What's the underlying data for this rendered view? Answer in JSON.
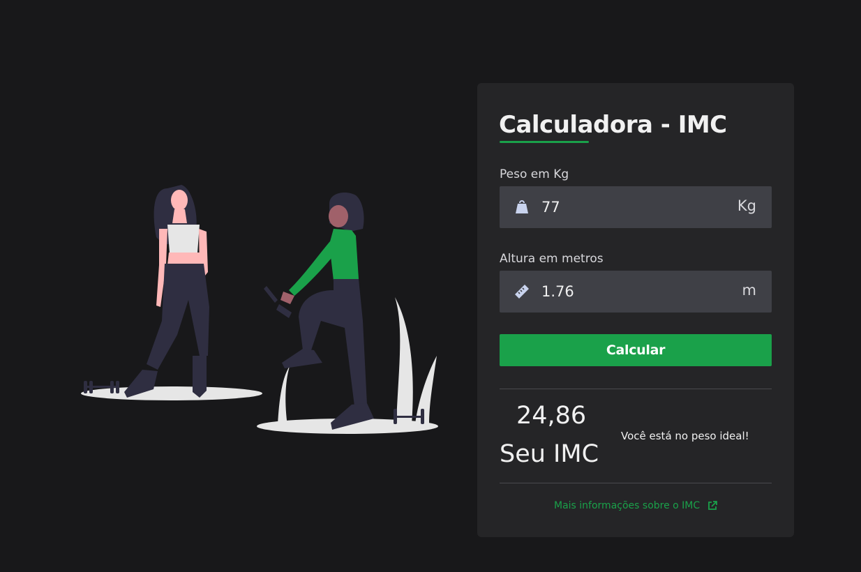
{
  "calculator": {
    "title": "Calculadora - IMC",
    "accent_color": "#1aa14a",
    "weight": {
      "label": "Peso em Kg",
      "value": "77",
      "unit": "Kg",
      "icon": "weight-icon"
    },
    "height": {
      "label": "Altura em metros",
      "value": "1.76",
      "unit": "m",
      "icon": "ruler-icon"
    },
    "button_label": "Calcular",
    "result": {
      "value": "24,86",
      "label": "Seu IMC",
      "status": "Você está no peso ideal!"
    },
    "more_info_link": {
      "label": "Mais informações sobre o IMC",
      "icon": "external-link-icon"
    }
  },
  "illustration": {
    "description_icon": "fitness-women-illustration"
  }
}
